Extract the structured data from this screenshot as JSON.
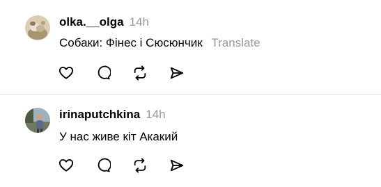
{
  "posts": [
    {
      "username": "olka.__olga",
      "timestamp": "14h",
      "text": "Собаки: Фінес і Сюсюнчик",
      "translate_label": "Translate",
      "actions": [
        "heart-icon",
        "comment-icon",
        "repost-icon",
        "share-icon"
      ]
    },
    {
      "username": "irinaputchkina",
      "timestamp": "14h",
      "text": "У нас живе кіт Акакий",
      "actions": [
        "heart-icon",
        "comment-icon",
        "repost-icon",
        "share-icon"
      ]
    }
  ],
  "colors": {
    "text": "#000000",
    "muted": "#999999",
    "divider": "#e0e0e0",
    "icon_stroke": "#000000"
  }
}
